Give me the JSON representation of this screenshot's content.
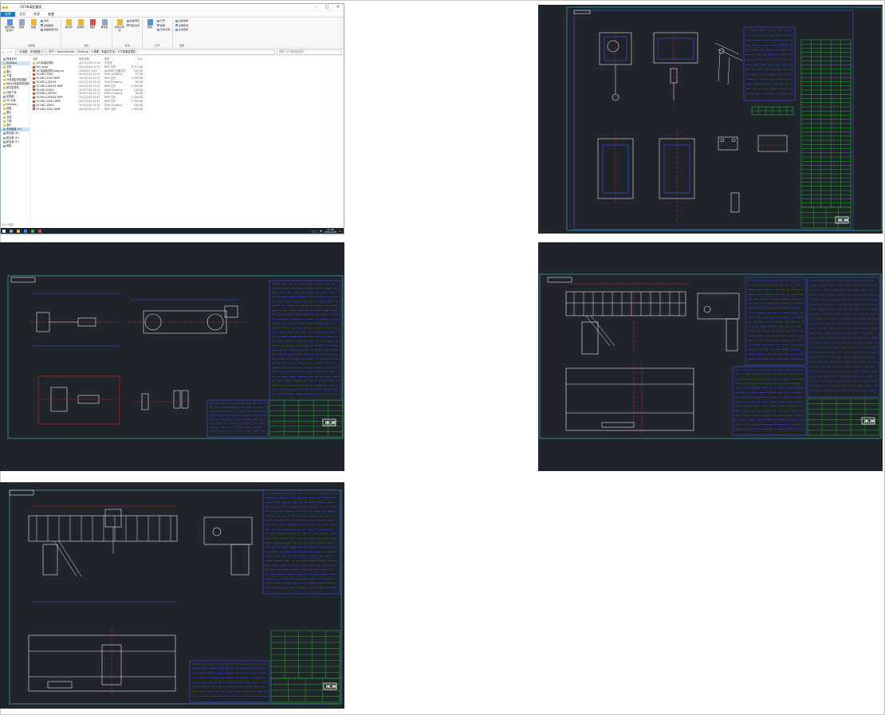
{
  "explorer": {
    "title": "10T单梁起重机",
    "tabs": [
      "文件",
      "主页",
      "共享",
      "查看"
    ],
    "ribbon": {
      "clipboard": {
        "label": "剪贴板",
        "pin": "固定到快速访问",
        "copy": "复制",
        "paste": "粘贴",
        "cut": "剪切",
        "copy_path": "复制路径",
        "paste_shortcut": "粘贴快捷方式"
      },
      "organize": {
        "label": "组织",
        "move_to": "移动到",
        "copy_to": "复制到",
        "delete": "删除",
        "rename": "重命名"
      },
      "new": {
        "label": "新建",
        "new_folder": "新建文件夹",
        "new_item": "新建项目",
        "easy_access": "轻松访问"
      },
      "open": {
        "label": "打开",
        "properties": "属性",
        "open": "打开",
        "edit": "编辑",
        "history": "历史记录"
      },
      "select": {
        "label": "选择",
        "select_all": "全部选择",
        "select_none": "全部取消",
        "invert": "反向选择"
      }
    },
    "address": {
      "path": "› 此电脑 › 本地磁盘 (C:) › 用户 › Administrator › Desktop › 小麦图 › 新建文件夹 › 10T单梁起重机 ›",
      "search_placeholder": "搜索\"10T单梁起重机\""
    },
    "tree": [
      {
        "label": "快速访问",
        "icon": "star-icon"
      },
      {
        "label": "Desktop",
        "icon": "folder-icon",
        "selected": true
      },
      {
        "label": "文档",
        "icon": "folder-icon"
      },
      {
        "label": "图片",
        "icon": "folder-icon"
      },
      {
        "label": "下载",
        "icon": "folder-icon"
      },
      {
        "label": "5t单梁起重机图纸",
        "icon": "folder-icon"
      },
      {
        "label": "WD50吨起重机图纸",
        "icon": "folder-icon"
      },
      {
        "label": "桥式起重机",
        "icon": "folder-icon"
      },
      {
        "label": "百度下载",
        "icon": "folder-icon"
      },
      {
        "label": "此电脑",
        "icon": "pc-icon"
      },
      {
        "label": "3D 对象",
        "icon": "folder-icon"
      },
      {
        "label": "Desktop",
        "icon": "folder-icon"
      },
      {
        "label": "视频",
        "icon": "folder-icon"
      },
      {
        "label": "图片",
        "icon": "folder-icon"
      },
      {
        "label": "文档",
        "icon": "folder-icon"
      },
      {
        "label": "下载",
        "icon": "folder-icon"
      },
      {
        "label": "音乐",
        "icon": "folder-icon"
      },
      {
        "label": "本地磁盘 (C:)",
        "icon": "drive-icon",
        "selected": true
      },
      {
        "label": "新加卷 (D:)",
        "icon": "drive-icon"
      },
      {
        "label": "新加卷 (E:)",
        "icon": "drive-icon"
      },
      {
        "label": "新加卷 (F:)",
        "icon": "drive-icon"
      },
      {
        "label": "网络",
        "icon": "network-icon"
      }
    ],
    "list_headers": [
      "名称",
      "修改日期",
      "类型",
      "大小"
    ],
    "files": [
      {
        "name": "10T单梁起重机",
        "date": "2021/2/26 11:09",
        "type": "文件夹",
        "size": "",
        "icon": "folder-icon"
      },
      {
        "name": "DEC.bmp",
        "date": "2021/2/26 10:57",
        "type": "BMP 文件",
        "size": "8,713 KB",
        "icon": "image-icon"
      },
      {
        "name": "10T单梁起重机.dwg.rar",
        "date": "2016/5/2 9:43",
        "type": "WinRAR 压缩文件",
        "size": "154 KB",
        "icon": "archive-icon"
      },
      {
        "name": "YS10B1-ZH01",
        "date": "2015/7/16 15:29",
        "type": "DWG Drawing",
        "size": "57 KB",
        "icon": "dwg-icon"
      },
      {
        "name": "YS10B1-ZH01.BMP",
        "date": "2021/2/26 10:57",
        "type": "BMP 文件",
        "size": "2,346 KB",
        "icon": "image-icon"
      },
      {
        "name": "YS10B1-LZ0H01",
        "date": "2015/7/16 15:29",
        "type": "DWG Drawing",
        "size": "86 KB",
        "icon": "dwg-icon"
      },
      {
        "name": "YS10B1-LZ0H01.BMP",
        "date": "2021/2/26 10:57",
        "type": "BMP 文件",
        "size": "2,346 KB",
        "icon": "image-icon"
      },
      {
        "name": "YS10B1-ZJH01",
        "date": "2015/7/16 15:29",
        "type": "DWG Drawing",
        "size": "108 KB",
        "icon": "dwg-icon"
      },
      {
        "name": "YS10B1-LZ0H02",
        "date": "2015/7/16 15:29",
        "type": "DWG Drawing",
        "size": "96 KB",
        "icon": "dwg-icon"
      },
      {
        "name": "YS10B1-LZ0H02.BMP",
        "date": "2021/2/26 10:57",
        "type": "BMP 文件",
        "size": "2,346 KB",
        "icon": "image-icon"
      },
      {
        "name": "YS10B1-ZJH01.BMP",
        "date": "2021/2/26 10:57",
        "type": "BMP 文件",
        "size": "2,346 KB",
        "icon": "image-icon"
      },
      {
        "name": "YS10B1-ZJH02",
        "date": "2015/7/16 15:29",
        "type": "DWG Drawing",
        "size": "108 KB",
        "icon": "dwg-icon"
      },
      {
        "name": "YS10B1-ZJH02.BMP",
        "date": "2021/2/26 10:57",
        "type": "BMP 文件",
        "size": "2,346 KB",
        "icon": "image-icon"
      }
    ],
    "status": "13 个项目",
    "taskbar": {
      "time": "11:09",
      "date": "2021/2/26",
      "lang": "中"
    }
  },
  "colors": {
    "cad_bg": "#20242b",
    "cad_frame": "#3bc6c6",
    "cad_line": "#e6e6e6",
    "cad_dim": "#3b4df0",
    "cad_center": "#e01b1b",
    "cad_table": "#22b022"
  }
}
